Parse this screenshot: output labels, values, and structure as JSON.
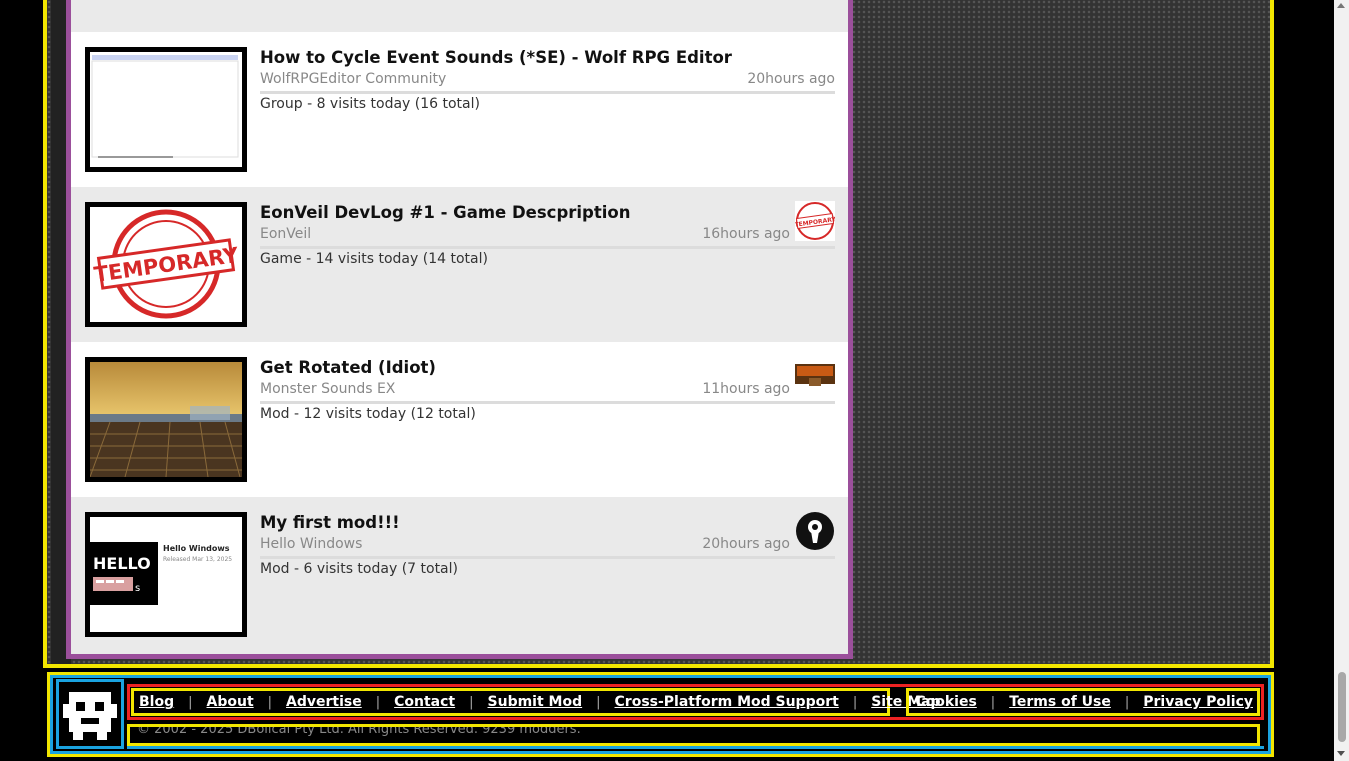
{
  "items": [
    {
      "title": "How to Cycle Event Sounds (*SE) - Wolf RPG Editor",
      "source": "WolfRPGEditor Community",
      "time": "20hours ago",
      "info": "Group - 8 visits today (16 total)",
      "thumb": "editor-screenshot",
      "badge": ""
    },
    {
      "title": "EonVeil DevLog #1 - Game Descpription",
      "source": "EonVeil",
      "time": "16hours ago",
      "info": "Game - 14 visits today (14 total)",
      "thumb": "temporary-stamp",
      "thumb_text": "TEMPORARY",
      "badge": "temporary-stamp"
    },
    {
      "title": "Get Rotated (Idiot)",
      "source": "Monster Sounds EX",
      "time": "11hours ago",
      "info": "Mod - 12 visits today (12 total)",
      "thumb": "game-landscape",
      "badge": "doom-logo"
    },
    {
      "title": "My first mod!!!",
      "source": "Hello Windows",
      "time": "20hours ago",
      "info": "Mod - 6 visits today (7 total)",
      "thumb": "hello-windows",
      "thumb_text": "HELLO",
      "thumb_caption": "Hello Windows",
      "thumb_date": "Released Mar 13, 2025",
      "badge": "keyhole-icon"
    }
  ],
  "footer": {
    "links_left": [
      "Blog",
      "About",
      "Advertise",
      "Contact",
      "Submit Mod",
      "Cross-Platform Mod Support",
      "Site Map"
    ],
    "links_right": [
      "Cookies",
      "Terms of Use",
      "Privacy Policy"
    ],
    "copyright": "© 2002 - 2025 DBolical Pty Ltd.  All Rights Reserved.  9239 modders."
  },
  "colors": {
    "frame_yellow": "#f2e600",
    "panel_purple": "#9b4f9b",
    "footer_blue": "#1aa3e0",
    "footer_red": "#e22222"
  }
}
